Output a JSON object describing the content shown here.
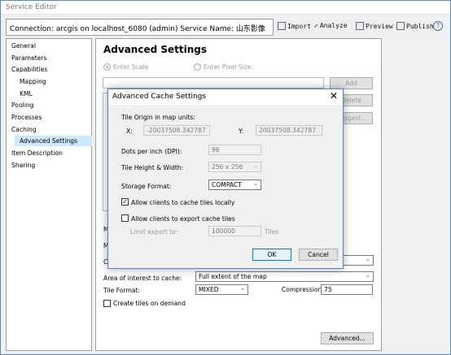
{
  "window": {
    "title": "Service Editor"
  },
  "toolbar": {
    "connection": "Connection: arcgis on localhost_6080 (admin)   Service Name: 山东影像",
    "import": "Import",
    "analyze": "Analyze",
    "preview": "Preview",
    "publish": "Publish",
    "help": "?"
  },
  "nav": {
    "items": [
      "General",
      "Parameters",
      "Capabilities",
      "Mapping",
      "KML",
      "Pooling",
      "Processes",
      "Caching",
      "Advanced Settings",
      "Item Description",
      "Sharing"
    ]
  },
  "panel": {
    "title": "Advanced Settings",
    "enter_scale": "Enter Scale",
    "enter_pixel_size": "Enter Pixel Size",
    "add": "Add",
    "delete": "Delete",
    "suggest": "Suggest...",
    "partial_label_1": "M",
    "partial_label_2": "M",
    "partial_label_3": "Ca",
    "area_label": "Area of interest to cache:",
    "area_value": "Full extent of the map",
    "tile_format_label": "Tile Format:",
    "tile_format_value": "MIXED",
    "compression_label": "Compression:",
    "compression_value": "75",
    "create_tiles_on_demand": "Create tiles on demand",
    "advanced_button": "Advanced..."
  },
  "dialog": {
    "title": "Advanced Cache Settings",
    "close": "✕",
    "tile_origin_label": "Tile Origin in map units:",
    "x_label": "X:",
    "x_value": "-20037508.342787",
    "y_label": "Y:",
    "y_value": "20037508.342787",
    "dpi_label": "Dots per inch (DPI):",
    "dpi_value": "96",
    "tile_size_label": "Tile Height & Width:",
    "tile_size_value": "256 x 256",
    "storage_label": "Storage Format:",
    "storage_value": "COMPACT",
    "allow_local": "Allow clients to cache tiles locally",
    "allow_local_checked": true,
    "allow_export": "Allow clients to export cache tiles",
    "allow_export_checked": false,
    "limit_label": "Limit export to:",
    "limit_value": "100000",
    "tiles_unit": "Tiles",
    "ok": "OK",
    "cancel": "Cancel"
  }
}
